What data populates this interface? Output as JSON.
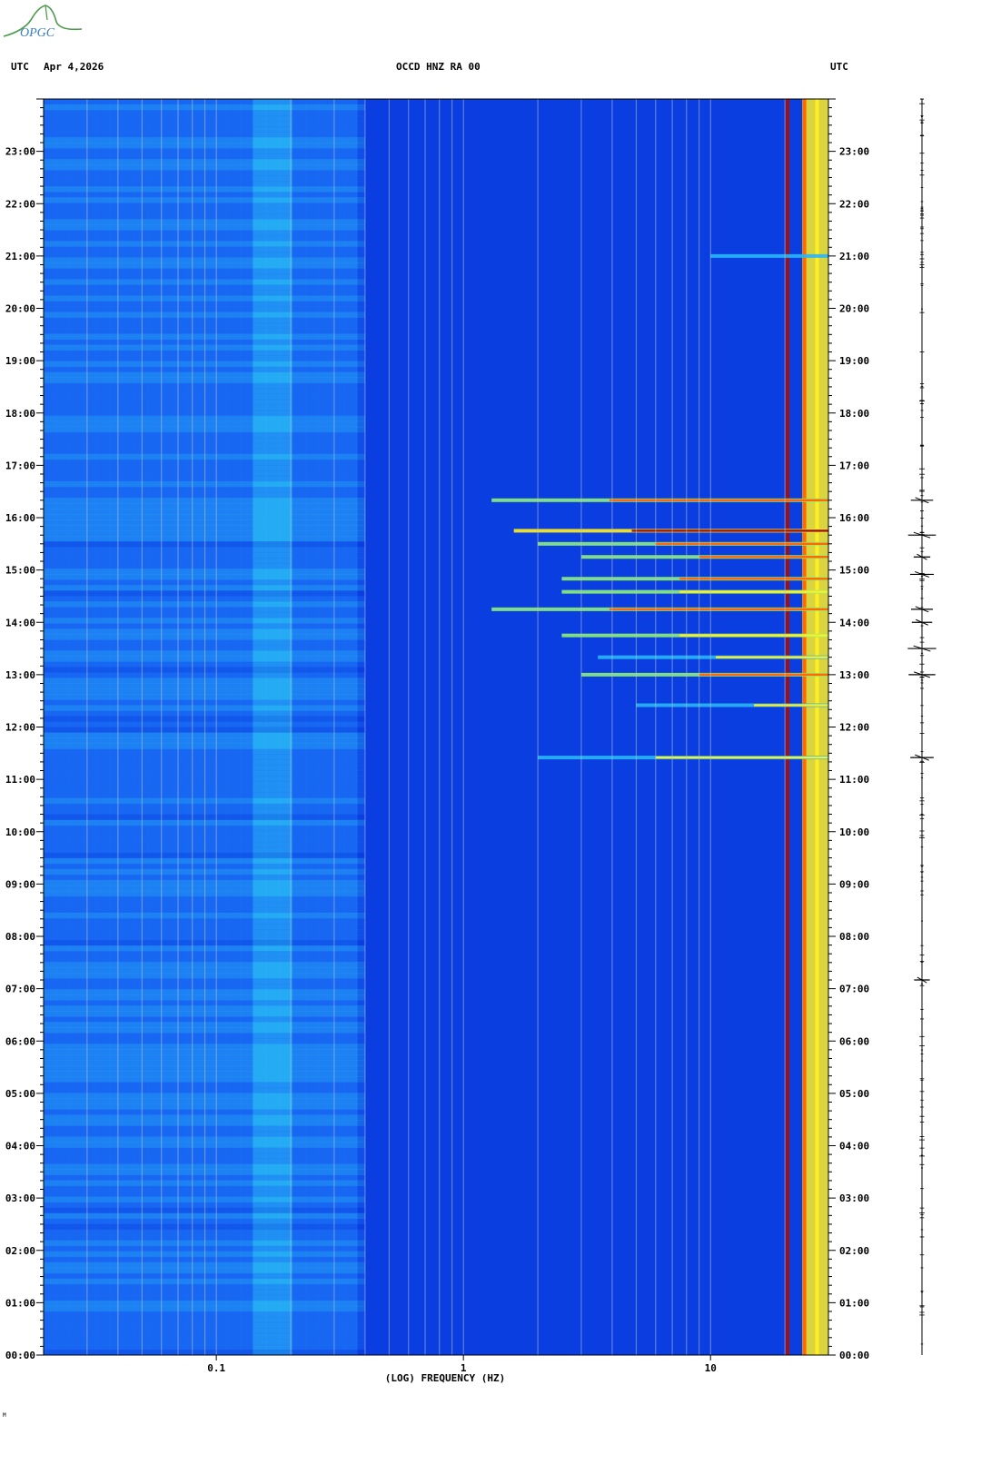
{
  "header": {
    "left_label": "UTC",
    "date": "Apr 4,2026",
    "station": "OCCD HNZ RA 00",
    "right_label": "UTC"
  },
  "logo_text": "OPGC",
  "footer_mark": "M",
  "chart_data": {
    "type": "heatmap",
    "title": "OCCD HNZ RA 00",
    "xlabel": "(LOG) FREQUENCY (HZ)",
    "x_scale": "log",
    "xlim": [
      0.02,
      30
    ],
    "x_tick_labels": [
      {
        "value": 0.1,
        "label": "0.1"
      },
      {
        "value": 1,
        "label": "1"
      },
      {
        "value": 10,
        "label": "10"
      }
    ],
    "ylabel": "UTC",
    "ylim": [
      0,
      24
    ],
    "y_tick_labels": [
      "00:00",
      "01:00",
      "02:00",
      "03:00",
      "04:00",
      "05:00",
      "06:00",
      "07:00",
      "08:00",
      "09:00",
      "10:00",
      "11:00",
      "12:00",
      "13:00",
      "14:00",
      "15:00",
      "16:00",
      "17:00",
      "18:00",
      "19:00",
      "20:00",
      "21:00",
      "22:00",
      "23:00"
    ],
    "colormap": [
      "#0010a0",
      "#0a3ee0",
      "#1a6cf5",
      "#29b6f6",
      "#8cf07a",
      "#ffee22",
      "#ff6a00",
      "#a01010"
    ],
    "persistent_bands_hz": [
      {
        "f_low": 0.025,
        "f_high": 0.048,
        "level": 0.3
      },
      {
        "f_low": 0.13,
        "f_high": 0.2,
        "level": 0.42
      },
      {
        "f_low": 23,
        "f_high": 30,
        "level": 0.75
      }
    ],
    "persistent_lines_hz": [
      {
        "f": 20.5,
        "level": 1.0
      },
      {
        "f": 24,
        "level": 0.8
      },
      {
        "f": 27,
        "level": 0.72
      }
    ],
    "events": [
      {
        "time": "11:25",
        "f_min": 2.0,
        "level": 0.7
      },
      {
        "time": "12:25",
        "f_min": 5.0,
        "level": 0.65
      },
      {
        "time": "13:00",
        "f_min": 3.0,
        "level": 0.8
      },
      {
        "time": "13:20",
        "f_min": 3.5,
        "level": 0.7
      },
      {
        "time": "13:45",
        "f_min": 2.5,
        "level": 0.75
      },
      {
        "time": "14:15",
        "f_min": 1.3,
        "level": 0.9
      },
      {
        "time": "14:35",
        "f_min": 2.5,
        "level": 0.75
      },
      {
        "time": "14:50",
        "f_min": 2.5,
        "level": 0.8
      },
      {
        "time": "15:15",
        "f_min": 3.0,
        "level": 0.8
      },
      {
        "time": "15:30",
        "f_min": 2.0,
        "level": 0.85
      },
      {
        "time": "15:45",
        "f_min": 1.6,
        "level": 0.95
      },
      {
        "time": "16:20",
        "f_min": 1.3,
        "level": 0.9
      },
      {
        "time": "21:00",
        "f_min": 10,
        "level": 0.6
      }
    ],
    "seismogram_events": [
      "07:10",
      "11:25",
      "13:00",
      "13:30",
      "14:00",
      "14:15",
      "14:55",
      "15:15",
      "15:40",
      "16:20"
    ]
  }
}
